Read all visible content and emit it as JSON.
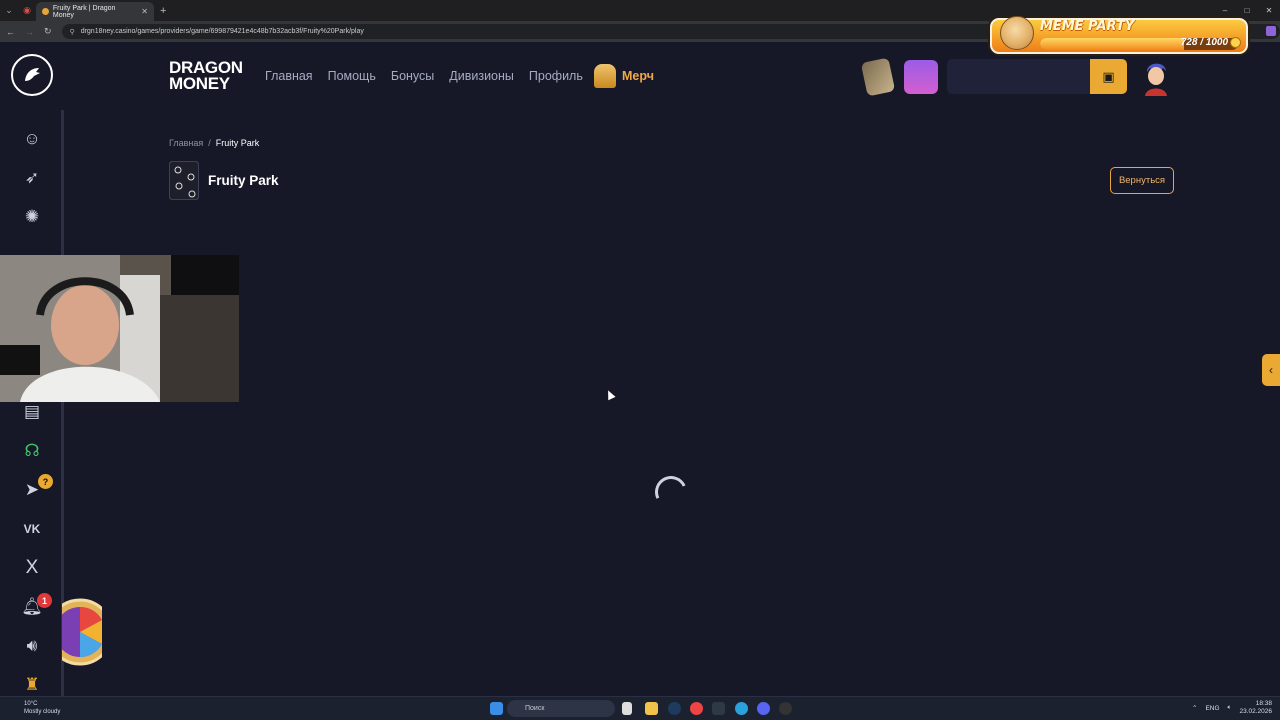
{
  "browser": {
    "tab_title": "Fruity Park | Dragon Money",
    "new_tab": "+",
    "url": "drgn18ney.casino/games/providers/game/699879421e4c48b7b32acb3f/Fruity%20Park/play",
    "window_buttons": [
      "–",
      "□",
      "✕"
    ]
  },
  "overlay": {
    "title": "MEME PARTY",
    "progress_current": 728,
    "progress_max": 1000,
    "progress_label": "728 / 1000"
  },
  "header": {
    "brand_line1": "DRAGON",
    "brand_line2": "MONEY",
    "nav": [
      "Главная",
      "Помощь",
      "Бонусы",
      "Дивизионы",
      "Профиль"
    ],
    "merch_label": "Мерч"
  },
  "breadcrumb": {
    "home": "Главная",
    "separator": "/",
    "current": "Fruity Park"
  },
  "game": {
    "title": "Fruity Park",
    "back_label": "Вернуться"
  },
  "sidebar": {
    "chat_badge": "?",
    "notifications_count": "1",
    "social_vk": "VK",
    "social_x": "X"
  },
  "taskbar": {
    "weather_temp": "10°C",
    "weather_text": "Mostly cloudy",
    "search_placeholder": "Поиск",
    "lang": "ENG",
    "time": "18:38",
    "date": "23.02.2026"
  },
  "colors": {
    "accent": "#e9a932",
    "background": "#161827",
    "nav_text": "#a7abc2"
  }
}
